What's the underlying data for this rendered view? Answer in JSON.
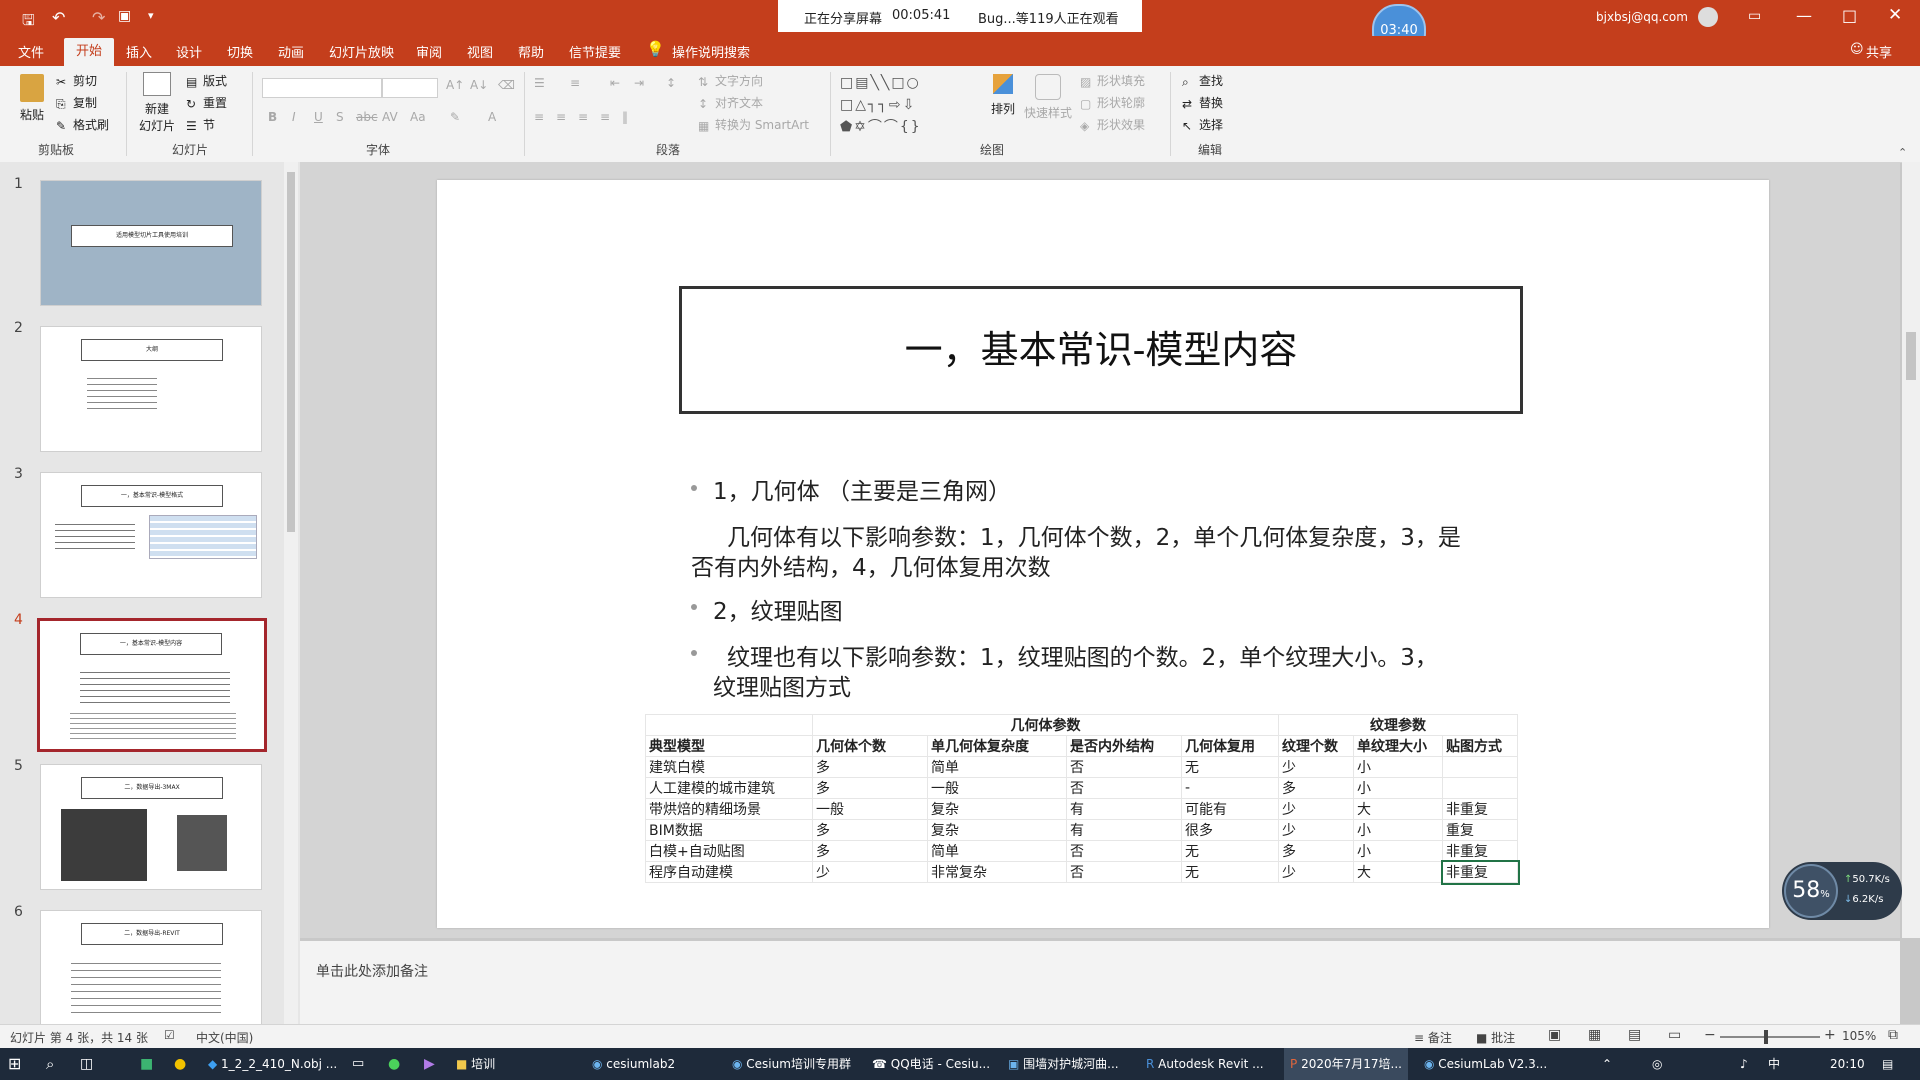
{
  "titlebar": {
    "share_text": "正在分享屏幕",
    "share_time": "00:05:41",
    "share_watch": "Bug...等119人正在观看",
    "timer": "03:40",
    "account": "bjxbsj@qq.com"
  },
  "tabs": [
    "文件",
    "开始",
    "插入",
    "设计",
    "切换",
    "动画",
    "幻灯片放映",
    "审阅",
    "视图",
    "帮助",
    "信节提要",
    "操作说明搜索"
  ],
  "share_label": "共享",
  "ribbon": {
    "clipboard": {
      "paste": "粘贴",
      "cut": "剪切",
      "copy": "复制",
      "format": "格式刷",
      "label": "剪贴板"
    },
    "slides": {
      "new": "新建",
      "new2": "幻灯片",
      "layout": "版式",
      "reset": "重置",
      "section": "节",
      "label": "幻灯片"
    },
    "font": {
      "label": "字体"
    },
    "paragraph": {
      "textdir": "文字方向",
      "align": "对齐文本",
      "smartart": "转换为 SmartArt",
      "label": "段落"
    },
    "drawing": {
      "arrange": "排列",
      "quickstyle": "快速样式",
      "fill": "形状填充",
      "outline": "形状轮廓",
      "effect": "形状效果",
      "label": "绘图"
    },
    "edit": {
      "find": "查找",
      "replace": "替换",
      "select": "选择",
      "label": "编辑"
    }
  },
  "thumbnails": [
    {
      "num": "1",
      "title": "适用模型切片工具使用培训"
    },
    {
      "num": "2",
      "title": "大纲"
    },
    {
      "num": "3",
      "title": "一，基本常识-模型格式"
    },
    {
      "num": "4",
      "title": "一，基本常识-模型内容"
    },
    {
      "num": "5",
      "title": "二，数据导出-3MAX"
    },
    {
      "num": "6",
      "title": "二，数据导出-REVIT"
    }
  ],
  "slide": {
    "title": "一，基本常识-模型内容",
    "b1": "1，几何体 （主要是三角网）",
    "p1a": "几何体有以下影响参数：1，几何体个数，2，单个几何体复杂度，3，是",
    "p1b": "否有内外结构，4，几何体复用次数",
    "b2": "2，纹理贴图",
    "p2a": "纹理也有以下影响参数：1，纹理贴图的个数。2，单个纹理大小。3，",
    "p2b": "纹理贴图方式",
    "table": {
      "group_geo": "几何体参数",
      "group_tex": "纹理参数",
      "headers": [
        "典型模型",
        "几何体个数",
        "单几何体复杂度",
        "是否内外结构",
        "几何体复用",
        "纹理个数",
        "单纹理大小",
        "贴图方式"
      ],
      "rows": [
        [
          "建筑白模",
          "多",
          "简单",
          "否",
          "无",
          "少",
          "小",
          ""
        ],
        [
          "人工建模的城市建筑",
          "多",
          "一般",
          "否",
          "-",
          "多",
          "小",
          ""
        ],
        [
          "带烘焙的精细场景",
          "一般",
          "复杂",
          "有",
          "可能有",
          "少",
          "大",
          "非重复"
        ],
        [
          "BIM数据",
          "多",
          "复杂",
          "有",
          "很多",
          "少",
          "小",
          "重复"
        ],
        [
          "白模+自动贴图",
          "多",
          "简单",
          "否",
          "无",
          "多",
          "小",
          "非重复"
        ],
        [
          "程序自动建模",
          "少",
          "非常复杂",
          "否",
          "无",
          "少",
          "大",
          "非重复"
        ]
      ]
    }
  },
  "notes_placeholder": "单击此处添加备注",
  "status": {
    "slide_info": "幻灯片 第 4 张，共 14 张",
    "lang": "中文(中国)",
    "notes": "备注",
    "comments": "批注",
    "zoom": "105%"
  },
  "perf": {
    "pct": "58",
    "pct_unit": "%",
    "up": "50.7",
    "down": "6.2",
    "unit": "K/s"
  },
  "taskbar": {
    "items": [
      "1_2_2_410_N.obj ...",
      "培训",
      "cesiumlab2",
      "Cesium培训专用群",
      "QQ电话 - Cesiu...",
      "围墙对护城河曲...",
      "Autodesk Revit ...",
      "2020年7月17培...",
      "CesiumLab V2.3..."
    ],
    "time": "20:10",
    "ime": "中"
  }
}
